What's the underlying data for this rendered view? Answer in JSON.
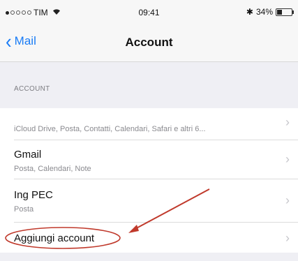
{
  "status_bar": {
    "carrier": "TIM",
    "time": "09:41",
    "bluetooth": "✱",
    "battery_percent": "34%",
    "battery_level": 0.34
  },
  "nav": {
    "back_label": "Mail",
    "title": "Account"
  },
  "section_header": "ACCOUNT",
  "accounts": [
    {
      "title": "",
      "subtitle": "iCloud Drive, Posta, Contatti, Calendari, Safari e altri 6..."
    },
    {
      "title": "Gmail",
      "subtitle": "Posta, Calendari, Note"
    },
    {
      "title": "Ing PEC",
      "subtitle": "Posta"
    }
  ],
  "add_account_label": "Aggiungi account",
  "chevron": "›",
  "colors": {
    "accent": "#1a7cf6",
    "annotation": "#c0392b"
  }
}
